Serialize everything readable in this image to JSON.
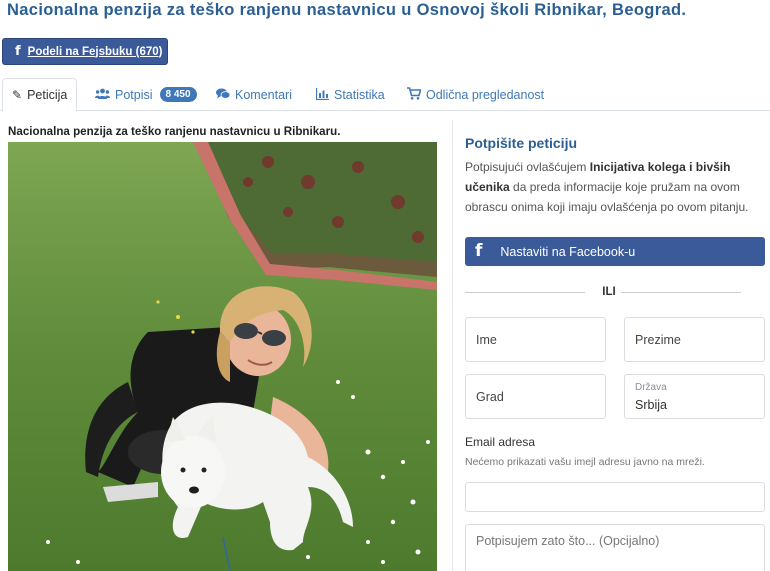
{
  "page": {
    "title": "Nacionalna penzija za teško ranjenu nastavnicu u Osnovoj školi Ribnikar, Beograd."
  },
  "share": {
    "label": "Podeli na Fejsbuku (670)",
    "icon": "facebook-icon",
    "color": "#3b5a9a"
  },
  "tabs": [
    {
      "label": "Peticija",
      "icon": "pencil-icon",
      "active": true
    },
    {
      "label": "Potpisi",
      "icon": "users-icon",
      "badge": "8 450"
    },
    {
      "label": "Komentari",
      "icon": "comments-icon"
    },
    {
      "label": "Statistika",
      "icon": "bar-chart-icon"
    },
    {
      "label": "Odlična pregledanost",
      "icon": "cart-icon"
    }
  ],
  "main": {
    "subtitle": "Nacionalna penzija za teško ranjenu nastavnicu u Ribnikaru."
  },
  "sign": {
    "title": "Potpišite peticiju",
    "desc_pre": "Potpisujući ovlašćujem ",
    "desc_bold": "Inicijativa kolega i bivših učenika",
    "desc_post": " da preda informacije koje pružam na ovom obrascu onima koji imaju ovlašćenja po ovom pitanju.",
    "facebook_button": "Nastaviti na Facebook-u",
    "or": "ILI",
    "fields": {
      "first_name": "Ime",
      "last_name": "Prezime",
      "city": "Grad",
      "country_label": "Država",
      "country_value": "Srbija",
      "email_label": "Email adresa",
      "email_hint": "Nećemo prikazati vašu imejl adresu javno na mreži.",
      "email_value": "",
      "comment_placeholder": "Potpisujem zato što... (Opcijalno)"
    }
  },
  "colors": {
    "brand_blue": "#2b5f93",
    "link_blue": "#3f78b8",
    "facebook": "#3b5a9a"
  }
}
